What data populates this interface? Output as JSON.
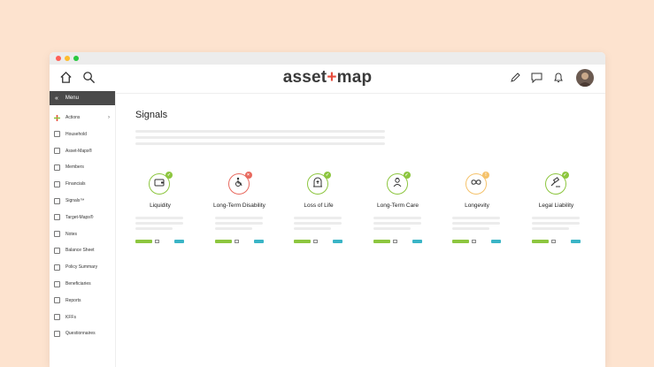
{
  "brand": {
    "logo_left": "asset",
    "logo_plus": "+",
    "logo_right": "map"
  },
  "sidebar": {
    "menu_label": "Menu",
    "items": [
      {
        "label": "Actions",
        "icon": "plus-icon",
        "has_arrow": true
      },
      {
        "label": "Household",
        "icon": "house-icon"
      },
      {
        "label": "Asset-Maps®",
        "icon": "map-icon"
      },
      {
        "label": "Members",
        "icon": "members-icon"
      },
      {
        "label": "Financials",
        "icon": "money-icon"
      },
      {
        "label": "Signals™",
        "icon": "shield-icon"
      },
      {
        "label": "Target-Maps®",
        "icon": "target-icon"
      },
      {
        "label": "Notes",
        "icon": "notes-icon"
      },
      {
        "label": "Balance Sheet",
        "icon": "balance-sheet-icon"
      },
      {
        "label": "Policy Summary",
        "icon": "policy-icon"
      },
      {
        "label": "Beneficiaries",
        "icon": "beneficiaries-icon"
      },
      {
        "label": "Reports",
        "icon": "reports-icon"
      },
      {
        "label": "KFFs",
        "icon": "gauge-icon"
      },
      {
        "label": "Questionnaires",
        "icon": "clipboard-icon"
      }
    ]
  },
  "main": {
    "title": "Signals",
    "signals": [
      {
        "name": "Liquidity",
        "status": "ok",
        "ring": "#8dc63f",
        "badge": "#8dc63f",
        "icon": "wallet-icon"
      },
      {
        "name": "Long-Term Disability",
        "status": "alert",
        "ring": "#e86a5f",
        "badge": "#e86a5f",
        "icon": "wheelchair-icon"
      },
      {
        "name": "Loss of Life",
        "status": "ok",
        "ring": "#8dc63f",
        "badge": "#8dc63f",
        "icon": "tombstone-icon"
      },
      {
        "name": "Long-Term Care",
        "status": "ok",
        "ring": "#8dc63f",
        "badge": "#8dc63f",
        "icon": "caregiver-icon"
      },
      {
        "name": "Longevity",
        "status": "warning",
        "ring": "#f5c26b",
        "badge": "#f5c26b",
        "icon": "infinity-icon"
      },
      {
        "name": "Legal Liability",
        "status": "ok",
        "ring": "#8dc63f",
        "badge": "#8dc63f",
        "icon": "gavel-icon"
      }
    ]
  },
  "colors": {
    "green": "#8dc63f",
    "teal": "#3ab5c6",
    "red": "#e86a5f",
    "yellow": "#f5c26b"
  }
}
